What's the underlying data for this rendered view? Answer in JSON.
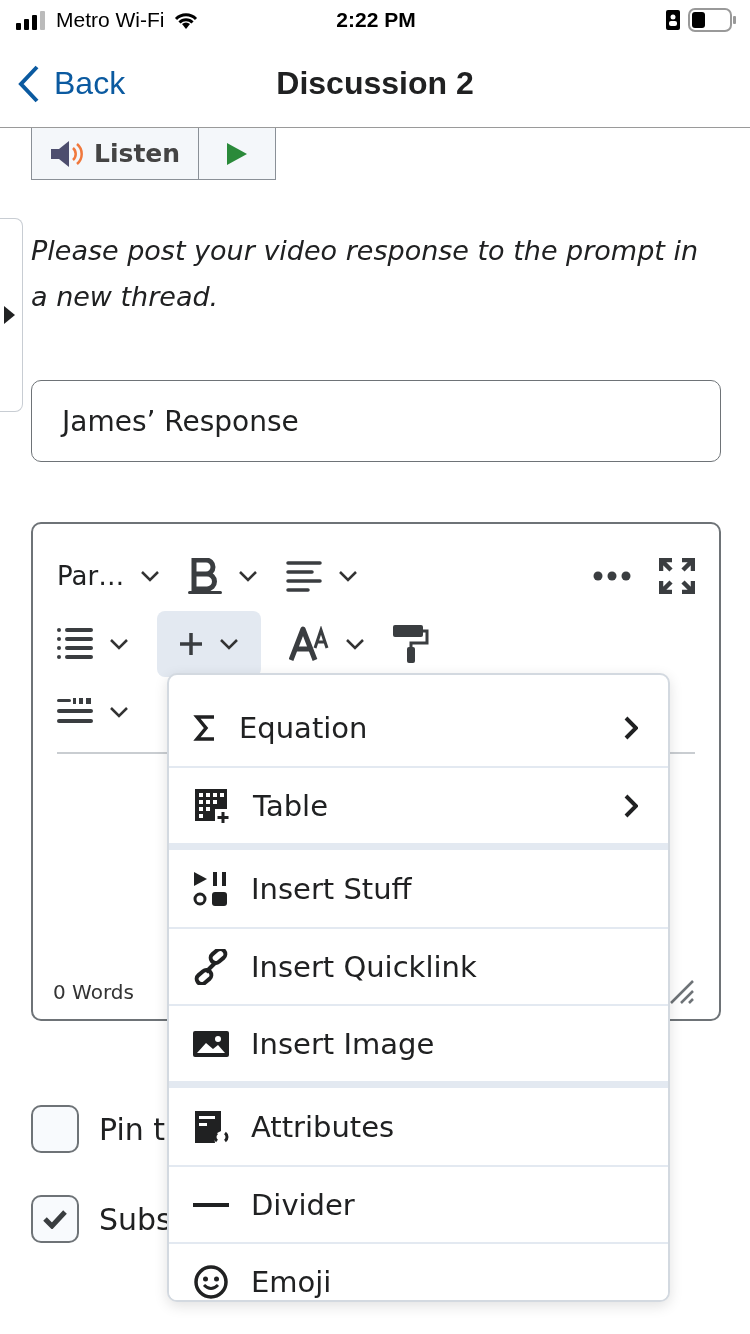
{
  "status_bar": {
    "carrier": "Metro Wi-Fi",
    "time": "2:22 PM"
  },
  "nav": {
    "back": "Back",
    "title": "Discussion 2"
  },
  "listen": {
    "label": "Listen"
  },
  "sidebar_toggle": {
    "expanded": false
  },
  "prompt": "Please post your video response to the prompt in a new thread.",
  "subject_field": {
    "value": "James’ Response"
  },
  "editor": {
    "format_label": "Par…",
    "insert_expanded": true,
    "word_count": "0 Words"
  },
  "insert_menu": {
    "groups": [
      [
        {
          "label": "Equation",
          "submenu": true
        },
        {
          "label": "Table",
          "submenu": true
        }
      ],
      [
        {
          "label": "Insert Stuff",
          "submenu": false
        },
        {
          "label": "Insert Quicklink",
          "submenu": false
        },
        {
          "label": "Insert Image",
          "submenu": false
        }
      ],
      [
        {
          "label": "Attributes",
          "submenu": false
        },
        {
          "label": "Divider",
          "submenu": false
        },
        {
          "label": "Emoji",
          "submenu": false
        }
      ]
    ]
  },
  "options": [
    {
      "label": "Pin t",
      "checked": false
    },
    {
      "label": "Subs",
      "checked": true
    }
  ]
}
